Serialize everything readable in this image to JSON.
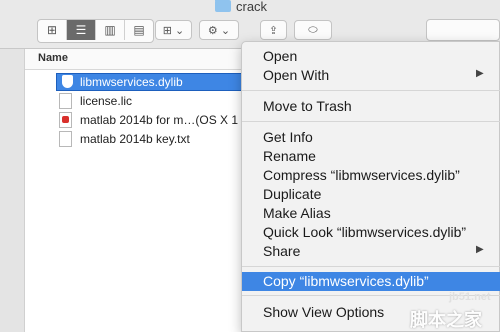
{
  "window": {
    "title": "crack"
  },
  "toolbar": {
    "view_icons": "icon-view-icon",
    "view_list": "list-view-icon",
    "view_columns": "column-view-icon",
    "view_coverflow": "coverflow-view-icon",
    "arrange_label": "⊞ ⌄",
    "action_label": "⚙ ⌄",
    "share_label": "⇪",
    "tag_label": "⬭"
  },
  "list": {
    "header_name": "Name",
    "files": [
      {
        "name": "libmwservices.dylib",
        "selected": true
      },
      {
        "name": "license.lic",
        "selected": false
      },
      {
        "name": "matlab 2014b for m…(OS X 1",
        "selected": false
      },
      {
        "name": "matlab 2014b key.txt",
        "selected": false
      }
    ]
  },
  "context_menu": {
    "items": [
      {
        "label": "Open"
      },
      {
        "label": "Open With",
        "submenu": true
      },
      {
        "label": "Move to Trash"
      },
      {
        "label": "Get Info"
      },
      {
        "label": "Rename"
      },
      {
        "label": "Compress “libmwservices.dylib”"
      },
      {
        "label": "Duplicate"
      },
      {
        "label": "Make Alias"
      },
      {
        "label": "Quick Look “libmwservices.dylib”"
      },
      {
        "label": "Share",
        "submenu": true
      },
      {
        "label": "Copy “libmwservices.dylib”",
        "highlighted": true
      },
      {
        "label": "Show View Options"
      }
    ],
    "submenu_arrow": "▶"
  },
  "watermark": {
    "line1": "jb51.net",
    "line2": "脚本之家"
  },
  "colors": {
    "accent": "#3e86e4",
    "menu_bg": "#f2f2f2",
    "toolbar_bg": "#e9e9e9"
  }
}
